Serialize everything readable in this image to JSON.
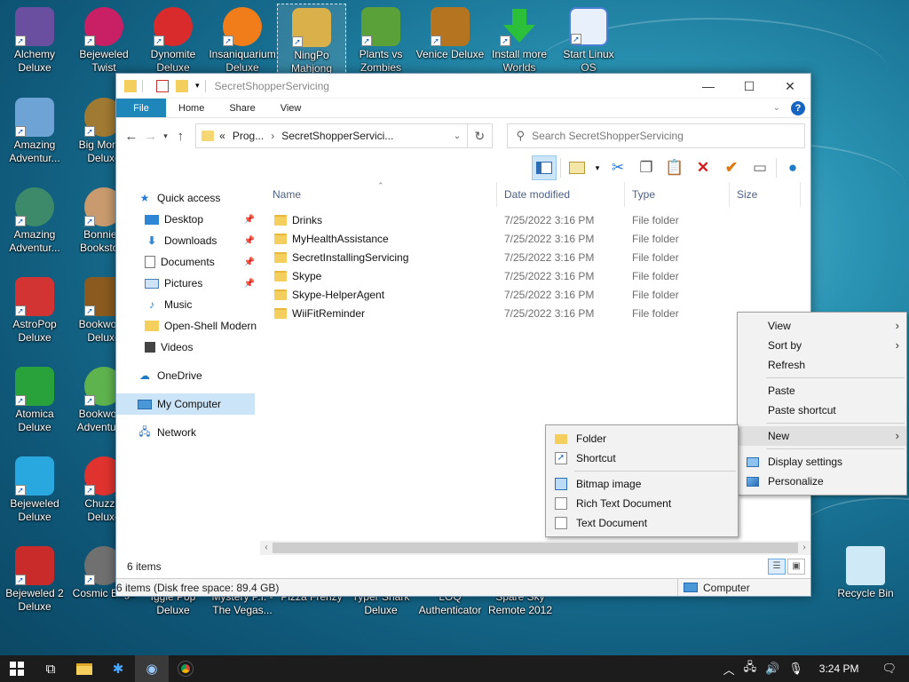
{
  "desktop": {
    "icons": [
      {
        "label": "Alchemy Deluxe",
        "color": "#6a4fa0"
      },
      {
        "label": "Bejeweled Twist",
        "color": "#c81f65"
      },
      {
        "label": "Dynomite Deluxe",
        "color": "#d92b2b"
      },
      {
        "label": "Insaniquarium Deluxe",
        "color": "#f07d1a"
      },
      {
        "label": "NingPo Mahjong",
        "color": "#d9b04a"
      },
      {
        "label": "Plants vs Zombies",
        "color": "#5aa13a"
      },
      {
        "label": "Venice Deluxe",
        "color": "#b5741f"
      },
      {
        "label": "Install more Worlds",
        "color": "#2cbf3a"
      },
      {
        "label": "Start Linux OS",
        "color": "#4a7fd1"
      },
      {
        "label": "Amazing Adventur...",
        "color": "#6ea3d6"
      },
      {
        "label": "Big Money Deluxe",
        "color": "#a07a32"
      },
      {
        "label": "Amazing Adventur...",
        "color": "#3c8a6a"
      },
      {
        "label": "Bonnie's Bookstore",
        "color": "#c99a6e"
      },
      {
        "label": "AstroPop Deluxe",
        "color": "#d23434"
      },
      {
        "label": "Bookworm Deluxe",
        "color": "#8a5a1f"
      },
      {
        "label": "Atomica Deluxe",
        "color": "#2aa23b"
      },
      {
        "label": "Bookworm Adventures",
        "color": "#5fb34e"
      },
      {
        "label": "Bejeweled Deluxe",
        "color": "#29a8e0"
      },
      {
        "label": "Chuzzle Deluxe",
        "color": "#e0332f"
      },
      {
        "label": "Bejeweled 2 Deluxe",
        "color": "#c92a2a"
      },
      {
        "label": "Cosmic Bugs",
        "color": "#707070"
      },
      {
        "label": "Iggle Pop Deluxe"
      },
      {
        "label": "Mystery P.I. - The Vegas..."
      },
      {
        "label": "Pizza Frenzy"
      },
      {
        "label": "Typer Shark Deluxe"
      },
      {
        "label": "LOQ Authenticator"
      },
      {
        "label": "Spare Sky Remote 2012"
      },
      {
        "label": "Recycle Bin",
        "color": "#9fd6f0"
      }
    ]
  },
  "explorer": {
    "title": "SecretShopperServicing",
    "controls": {
      "minimize": "—",
      "maximize": "☐",
      "close": "✕"
    },
    "ribbon_tabs": [
      "File",
      "Home",
      "Share",
      "View"
    ],
    "help_label": "?",
    "address": {
      "prefix": "«",
      "crumb1": "Prog...",
      "crumb2": "SecretShopperServici..."
    },
    "search_placeholder": "Search SecretShopperServicing",
    "columns": [
      "Name",
      "Date modified",
      "Type",
      "Size"
    ],
    "files": [
      {
        "name": "Drinks",
        "date": "7/25/2022 3:16 PM",
        "type": "File folder"
      },
      {
        "name": "MyHealthAssistance",
        "date": "7/25/2022 3:16 PM",
        "type": "File folder"
      },
      {
        "name": "SecretInstallingServicing",
        "date": "7/25/2022 3:16 PM",
        "type": "File folder"
      },
      {
        "name": "Skype",
        "date": "7/25/2022 3:16 PM",
        "type": "File folder"
      },
      {
        "name": "Skype-HelperAgent",
        "date": "7/25/2022 3:16 PM",
        "type": "File folder"
      },
      {
        "name": "WiiFitReminder",
        "date": "7/25/2022 3:16 PM",
        "type": "File folder"
      }
    ],
    "nav_pane": [
      {
        "label": "Quick access",
        "icon": "star-icon"
      },
      {
        "label": "Desktop",
        "icon": "desktop-icon",
        "pinned": true
      },
      {
        "label": "Downloads",
        "icon": "download-icon",
        "pinned": true
      },
      {
        "label": "Documents",
        "icon": "document-icon",
        "pinned": true
      },
      {
        "label": "Pictures",
        "icon": "picture-icon",
        "pinned": true
      },
      {
        "label": "Music",
        "icon": "music-icon"
      },
      {
        "label": "Open-Shell Modern",
        "icon": "folder-icon"
      },
      {
        "label": "Videos",
        "icon": "video-icon"
      },
      {
        "label": "OneDrive",
        "icon": "cloud-icon"
      },
      {
        "label": "My Computer",
        "icon": "computer-icon"
      },
      {
        "label": "Network",
        "icon": "network-icon"
      }
    ],
    "item_count": "6 items",
    "status_left": "6 items (Disk free space: 89.4 GB)",
    "status_right": "Computer"
  },
  "context_menu": {
    "items": [
      {
        "label": "View",
        "submenu": true
      },
      {
        "label": "Sort by",
        "submenu": true
      },
      {
        "label": "Refresh"
      },
      {
        "label": "Paste"
      },
      {
        "label": "Paste shortcut"
      },
      {
        "label": "New",
        "submenu": true
      },
      {
        "label": "Display settings"
      },
      {
        "label": "Personalize"
      }
    ]
  },
  "new_submenu": {
    "items": [
      "Folder",
      "Shortcut",
      "Bitmap image",
      "Rich Text Document",
      "Text Document"
    ]
  },
  "taskbar": {
    "time": "3:24 PM"
  },
  "colors": {
    "accent": "#1e86b8",
    "folder": "#f5cf5e",
    "taskbar": "#1c1c1c"
  }
}
